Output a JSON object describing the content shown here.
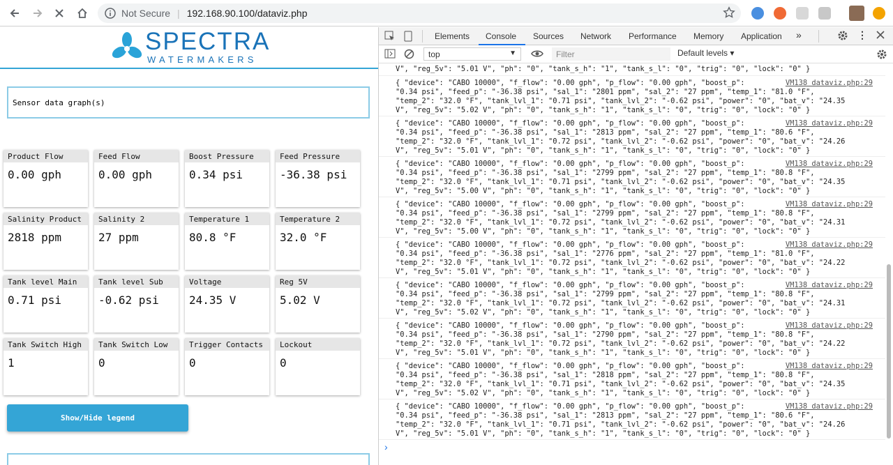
{
  "browser": {
    "security_label": "Not Secure",
    "url": "192.168.90.100/dataviz.php"
  },
  "logo": {
    "line1": "SPECTRA",
    "line2": "WATERMAKERS"
  },
  "graph_box_label": "Sensor data graph(s)",
  "cards": [
    {
      "label": "Product Flow",
      "value": "0.00 gph"
    },
    {
      "label": "Feed Flow",
      "value": "0.00 gph"
    },
    {
      "label": "Boost Pressure",
      "value": "0.34 psi"
    },
    {
      "label": "Feed Pressure",
      "value": "-36.38 psi"
    },
    {
      "label": "Salinity Product",
      "value": "2818 ppm"
    },
    {
      "label": "Salinity 2",
      "value": "27 ppm"
    },
    {
      "label": "Temperature 1",
      "value": "80.8 °F"
    },
    {
      "label": "Temperature 2",
      "value": "32.0 °F"
    },
    {
      "label": "Tank level Main",
      "value": "0.71 psi"
    },
    {
      "label": "Tank level Sub",
      "value": "-0.62 psi"
    },
    {
      "label": "Voltage",
      "value": "24.35 V"
    },
    {
      "label": "Reg 5V",
      "value": "5.02 V"
    },
    {
      "label": "Tank Switch High",
      "value": "1"
    },
    {
      "label": "Tank Switch Low",
      "value": "0"
    },
    {
      "label": "Trigger Contacts",
      "value": "0"
    },
    {
      "label": "Lockout",
      "value": "0"
    }
  ],
  "legend_button": "Show/Hide legend",
  "devtools": {
    "tabs": [
      "Elements",
      "Console",
      "Sources",
      "Network",
      "Performance",
      "Memory",
      "Application"
    ],
    "active_tab": "Console",
    "context": "top",
    "filter_placeholder": "Filter",
    "levels": "Default levels ▾",
    "partial_line": "V\", \"reg_5v\": \"5.01 V\", \"ph\": \"0\", \"tank_s_h\": \"1\", \"tank_s_l\": \"0\", \"trig\": \"0\", \"lock\": \"0\" }",
    "source": "VM138 dataviz.php:29",
    "entries": [
      {
        "sal_1": "2801",
        "temp_1": "81.0",
        "tank_lvl_1": "0.71",
        "bat_v": "24.35",
        "reg_5v": "5.02"
      },
      {
        "sal_1": "2813",
        "temp_1": "80.6",
        "tank_lvl_1": "0.72",
        "bat_v": "24.26",
        "reg_5v": "5.01"
      },
      {
        "sal_1": "2799",
        "temp_1": "80.8",
        "tank_lvl_1": "0.71",
        "bat_v": "24.35",
        "reg_5v": "5.00"
      },
      {
        "sal_1": "2799",
        "temp_1": "80.8",
        "tank_lvl_1": "0.72",
        "bat_v": "24.31",
        "reg_5v": "5.00"
      },
      {
        "sal_1": "2776",
        "temp_1": "81.0",
        "tank_lvl_1": "0.72",
        "bat_v": "24.22",
        "reg_5v": "5.01"
      },
      {
        "sal_1": "2799",
        "temp_1": "80.8",
        "tank_lvl_1": "0.72",
        "bat_v": "24.31",
        "reg_5v": "5.02"
      },
      {
        "sal_1": "2790",
        "temp_1": "80.8",
        "tank_lvl_1": "0.72",
        "bat_v": "24.22",
        "reg_5v": "5.01"
      },
      {
        "sal_1": "2818",
        "temp_1": "80.8",
        "tank_lvl_1": "0.71",
        "bat_v": "24.35",
        "reg_5v": "5.02"
      },
      {
        "sal_1": "2813",
        "temp_1": "80.6",
        "tank_lvl_1": "0.71",
        "bat_v": "24.26",
        "reg_5v": "5.01"
      }
    ]
  }
}
